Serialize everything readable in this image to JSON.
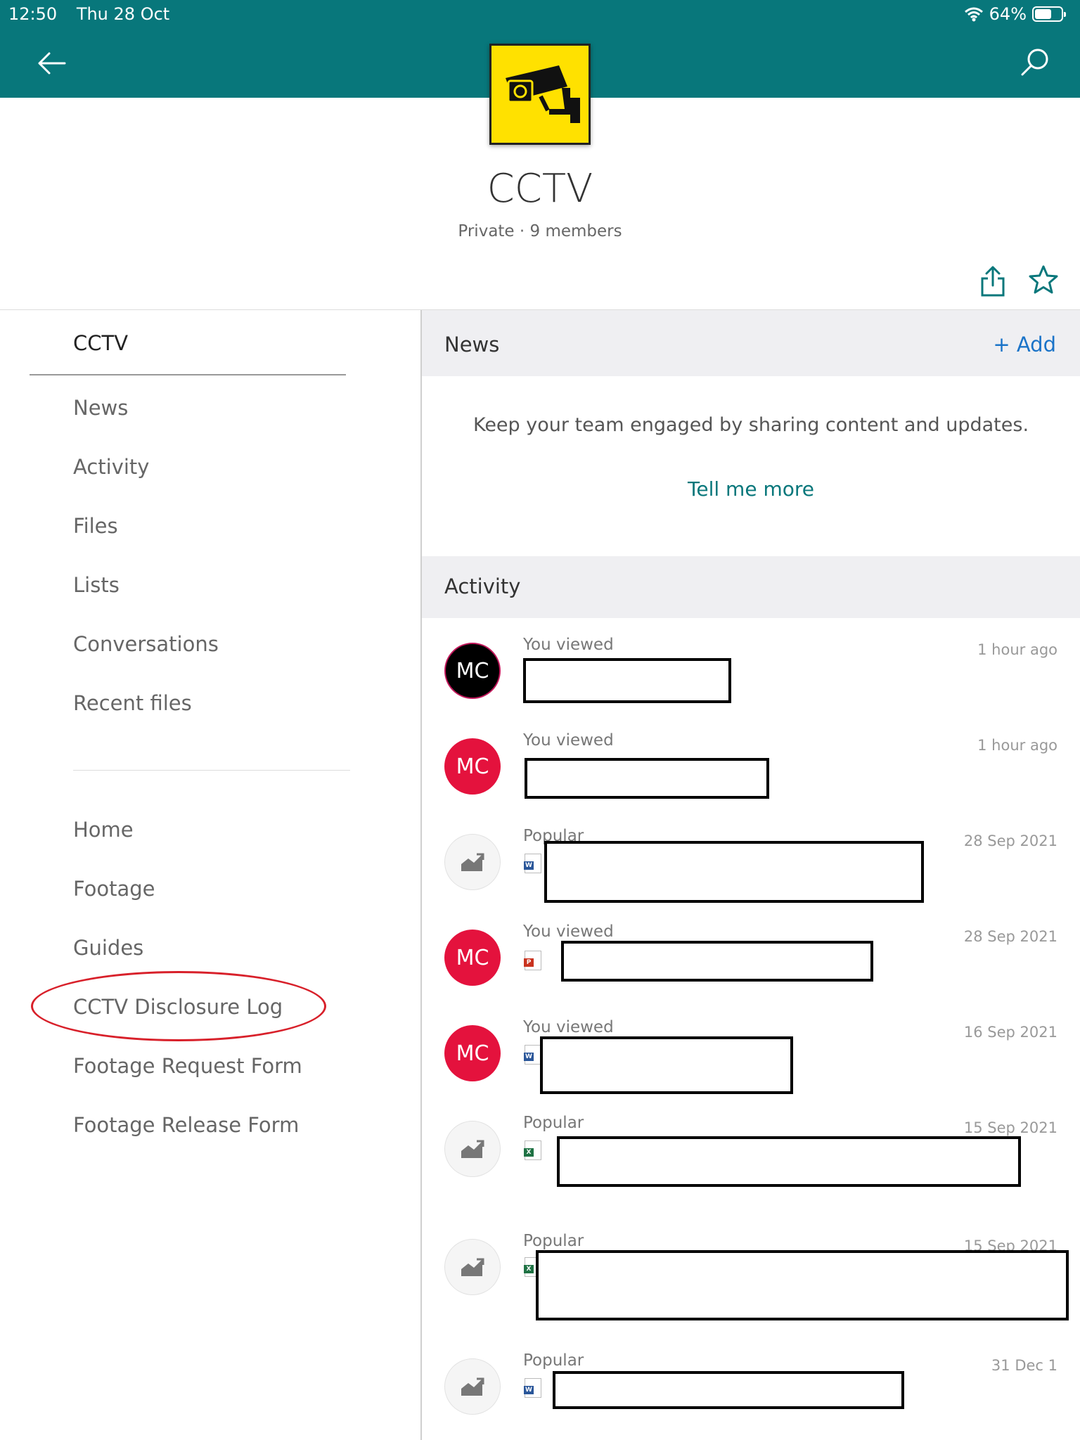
{
  "status_bar": {
    "time": "12:50",
    "date": "Thu 28 Oct",
    "battery": "64%",
    "battery_level": 0.64
  },
  "site": {
    "title": "CCTV",
    "meta": "Private · 9 members"
  },
  "nav": {
    "title": "CCTV",
    "items": [
      "News",
      "Activity",
      "Files",
      "Lists",
      "Conversations",
      "Recent files"
    ],
    "links": [
      "Home",
      "Footage",
      "Guides",
      "CCTV Disclosure Log",
      "Footage Request Form",
      "Footage Release Form"
    ]
  },
  "news": {
    "heading": "News",
    "add_label": "+ Add",
    "empty_text": "Keep your team engaged by sharing content and updates.",
    "tell_more": "Tell me more"
  },
  "activity": {
    "heading": "Activity",
    "items": [
      {
        "kind": "You viewed",
        "time": "1 hour ago",
        "avatar": "MC",
        "avatar_style": "black",
        "file_type": ""
      },
      {
        "kind": "You viewed",
        "time": "1 hour ago",
        "avatar": "MC",
        "avatar_style": "red",
        "file_type": ""
      },
      {
        "kind": "Popular",
        "time": "28 Sep 2021",
        "avatar": "",
        "avatar_style": "gray",
        "file_type": "word"
      },
      {
        "kind": "You viewed",
        "time": "28 Sep 2021",
        "avatar": "MC",
        "avatar_style": "red",
        "file_type": "pdf"
      },
      {
        "kind": "You viewed",
        "time": "16 Sep 2021",
        "avatar": "MC",
        "avatar_style": "red",
        "file_type": "word"
      },
      {
        "kind": "Popular",
        "time": "15 Sep 2021",
        "avatar": "",
        "avatar_style": "gray",
        "file_type": "excel"
      },
      {
        "kind": "Popular",
        "time": "15 Sep 2021",
        "avatar": "",
        "avatar_style": "gray",
        "file_type": "excel"
      },
      {
        "kind": "Popular",
        "time": "31 Dec 1",
        "avatar": "",
        "avatar_style": "gray",
        "file_type": "word"
      }
    ]
  },
  "colors": {
    "header": "#08777b",
    "accent_link": "#1a73c8",
    "avatar_red": "#e4123d",
    "logo_yellow": "#ffe100",
    "annotation": "#d8202a"
  },
  "icons": {
    "back": "arrow-left-icon",
    "search": "search-icon",
    "share": "share-icon",
    "favorite": "star-icon",
    "logo": "cctv-camera-icon",
    "trending": "trending-chart-icon"
  }
}
